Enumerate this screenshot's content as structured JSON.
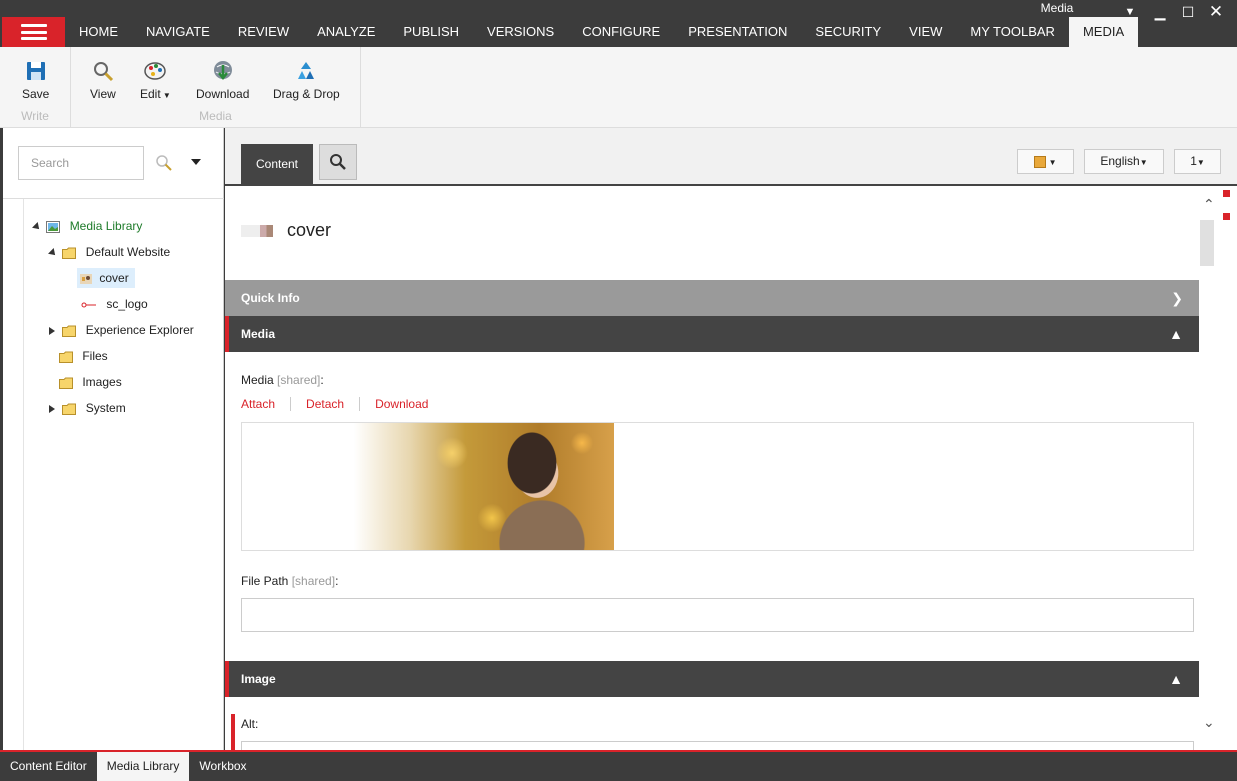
{
  "window": {
    "title": "Media"
  },
  "menu": {
    "tabs": [
      "HOME",
      "NAVIGATE",
      "REVIEW",
      "ANALYZE",
      "PUBLISH",
      "VERSIONS",
      "CONFIGURE",
      "PRESENTATION",
      "SECURITY",
      "VIEW",
      "MY TOOLBAR",
      "MEDIA"
    ],
    "active_tab": "MEDIA"
  },
  "ribbon": {
    "write_group": {
      "label": "Write",
      "save": "Save"
    },
    "media_group": {
      "label": "Media",
      "view": "View",
      "edit": "Edit",
      "download": "Download",
      "drag_drop": "Drag & Drop"
    }
  },
  "sidebar": {
    "search_placeholder": "Search",
    "tree": [
      {
        "label": "Media Library",
        "level": 0,
        "state": "expanded"
      },
      {
        "label": "Default Website",
        "level": 1,
        "state": "expanded"
      },
      {
        "label": "cover",
        "level": 2,
        "state": "leaf",
        "selected": true
      },
      {
        "label": "sc_logo",
        "level": 2,
        "state": "leaf"
      },
      {
        "label": "Experience Explorer",
        "level": 1,
        "state": "collapsed"
      },
      {
        "label": "Files",
        "level": 1,
        "state": "leaf"
      },
      {
        "label": "Images",
        "level": 1,
        "state": "leaf"
      },
      {
        "label": "System",
        "level": 1,
        "state": "collapsed"
      }
    ]
  },
  "editor": {
    "content_tab": "Content",
    "language": "English",
    "version": "1",
    "item_name": "cover",
    "sections": {
      "quick_info": "Quick Info",
      "media": "Media",
      "image": "Image"
    },
    "fields": {
      "media_label": "Media",
      "media_shared": "[shared]",
      "media_actions": [
        "Attach",
        "Detach",
        "Download"
      ],
      "file_path_label": "File Path",
      "file_path_shared": "[shared]",
      "file_path_value": "",
      "alt_label": "Alt:"
    }
  },
  "bottom_tabs": [
    "Content Editor",
    "Media Library",
    "Workbox"
  ],
  "active_bottom_tab": "Media Library",
  "colors": {
    "accent": "#d9232a",
    "dark": "#3c3c3c",
    "tree_green": "#1e7b2a"
  }
}
